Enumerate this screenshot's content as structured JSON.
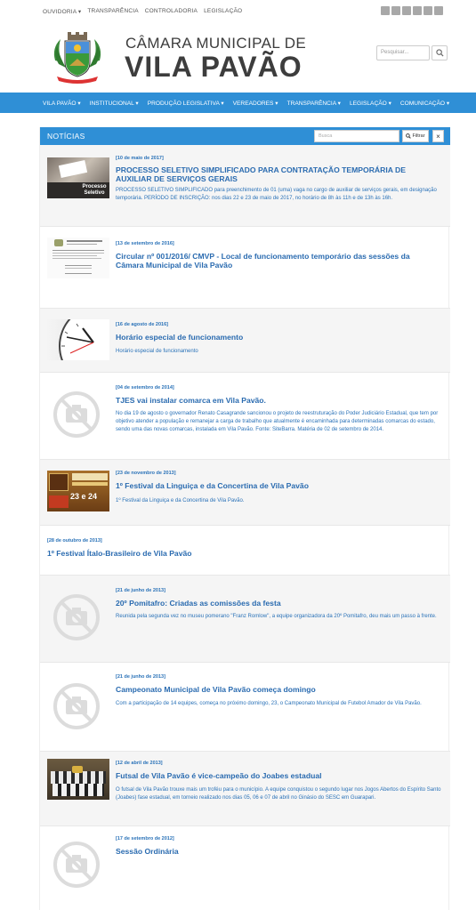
{
  "topbar": {
    "links": [
      "OUVIDORIA ▾",
      "TRANSPARÊNCIA",
      "CONTROLADORIA",
      "LEGISLAÇÃO"
    ]
  },
  "header": {
    "title_line1": "CÂMARA MUNICIPAL DE",
    "title_line2": "VILA PAVÃO",
    "search_placeholder": "Pesquisar..."
  },
  "nav": {
    "items": [
      "VILA PAVÃO ▾",
      "INSTITUCIONAL ▾",
      "PRODUÇÃO LEGISLATIVA ▾",
      "VEREADORES ▾",
      "TRANSPARÊNCIA ▾",
      "LEGISLAÇÃO ▾",
      "COMUNICAÇÃO ▾"
    ]
  },
  "panel": {
    "title": "NOTÍCIAS",
    "search_placeholder": "Busca",
    "filter_label": "Filtrar",
    "close_label": "×"
  },
  "news": [
    {
      "date": "[10 de maio de 2017]",
      "title": "PROCESSO SELETIVO SIMPLIFICADO PARA CONTRATAÇÃO TEMPORÁRIA DE AUXILIAR DE SERVIÇOS GERAIS",
      "summary": "PROCESSO SELETIVO SIMPLIFICADO para preenchimento de 01 (uma) vaga no cargo de auxiliar de serviços gerais, em designação temporária. PERÍODO DE INSCRIÇÃO: nos dias 22 e 23 de maio de 2017, no horário de 8h às 11h e de 13h às 16h.",
      "thumb_text": "Processo Seletivo"
    },
    {
      "date": "[13 de setembro de 2016]",
      "title": "Circular nº 001/2016/ CMVP - Local de funcionamento temporário das sessões da Câmara Municipal de Vila Pavão",
      "summary": ""
    },
    {
      "date": "[16 de agosto de 2016]",
      "title": "Horário especial de funcionamento",
      "summary": "Horário especial de funcionamento"
    },
    {
      "date": "[04 de setembro de 2014]",
      "title": "TJES vai instalar comarca em Vila Pavão.",
      "summary": "No dia 19 de agosto o governador Renato Casagrande sancionou o projeto de reestruturação do Poder Judiciário Estadual, que tem por objetivo atender a população e remanejar a carga de trabalho que atualmente é encaminhada para determinadas comarcas do estado, sendo uma das novas comarcas, instalada em Vila Pavão. Fonte: SiteBarra. Matéria de 02 de setembro de 2014."
    },
    {
      "date": "[23 de novembro de 2013]",
      "title": "1º Festival da Linguiça e da Concertina de Vila Pavão",
      "summary": "1º Festival da Linguiça e da Concertina de Vila Pavão.",
      "thumb_text": "23 e 24"
    },
    {
      "date": "[28 de outubro de 2013]",
      "title": "1º Festival Ítalo-Brasileiro de Vila Pavão",
      "summary": ""
    },
    {
      "date": "[21 de junho de 2013]",
      "title": "20º Pomitafro: Criadas as comissões da festa",
      "summary": "Reunida pela segunda vez no museu pomerano \"Franz Romlow\", a equipe organizadora da 20º Pomitafro, deu mais um passo à frente."
    },
    {
      "date": "[21 de junho de 2013]",
      "title": "Campeonato Municipal de Vila Pavão começa domingo",
      "summary": "Com a participação de 14 equipes, começa no próximo domingo, 23, o Campeonato Municipal de Futebol Amador de Vila Pavão."
    },
    {
      "date": "[12 de abril de 2013]",
      "title": "Futsal de Vila Pavão é vice-campeão do Joabes estadual",
      "summary": "O futsal de Vila Pavão trouxe mais um troféu para o município. A equipe conquistou o segundo lugar nos Jogos Abertos do Espírito Santo (Joabes) fase estadual, em torneio realizado nos dias 05, 06 e 07 de abril no Ginásio do SESC em Guarapari."
    },
    {
      "date": "[17 de setembro de 2012]",
      "title": "Sessão Ordinária",
      "summary": ""
    }
  ],
  "colors": {
    "accent": "#2f8fd6",
    "link": "#2a6bb0"
  }
}
